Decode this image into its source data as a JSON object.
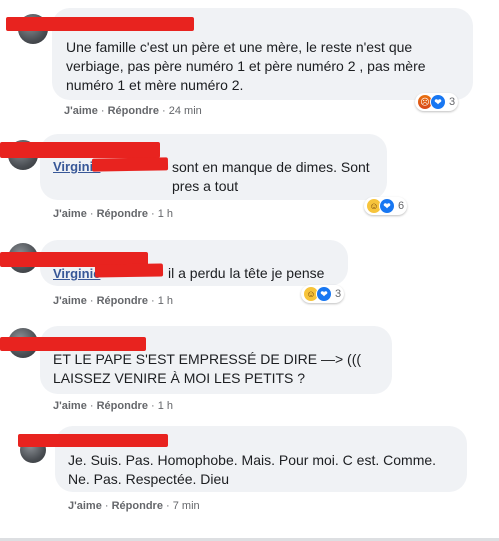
{
  "comments": [
    {
      "text": "Une famille c'est un père et une mère, le reste n'est que verbiage, pas père numéro 1 et père numéro 2 , pas mère numéro 1 et mère numéro 2.",
      "like": "J'aime",
      "reply": "Répondre",
      "time": "24 min",
      "reaction_count": "3",
      "reaction_icons": [
        "angry-icon",
        "care-icon"
      ]
    },
    {
      "mention": "Virginie",
      "text": "sont en manque de dimes. Sont pres a tout",
      "like": "J'aime",
      "reply": "Répondre",
      "time": "1 h",
      "reaction_count": "6",
      "reaction_icons": [
        "haha-icon",
        "care-icon"
      ]
    },
    {
      "mention": "Virginie",
      "text": "il a perdu la tête je pense",
      "like": "J'aime",
      "reply": "Répondre",
      "time": "1 h",
      "reaction_count": "3",
      "reaction_icons": [
        "haha-icon",
        "care-icon"
      ]
    },
    {
      "text": "ET LE PAPE S'EST EMPRESSÉ DE DIRE —> ((( LAISSEZ VENIRE À MOI LES PETITS ?",
      "like": "J'aime",
      "reply": "Répondre",
      "time": "1 h"
    },
    {
      "text": "Je. Suis. Pas. Homophobe. Mais. Pour moi. C est. Comme. Ne. Pas. Respectée. Dieu",
      "like": "J'aime",
      "reply": "Répondre",
      "time": "7 min"
    }
  ],
  "separator": "·",
  "colors": {
    "redaction": "#e8231f",
    "bubble": "#f0f2f5",
    "link": "#385898",
    "meta": "#65676b"
  }
}
